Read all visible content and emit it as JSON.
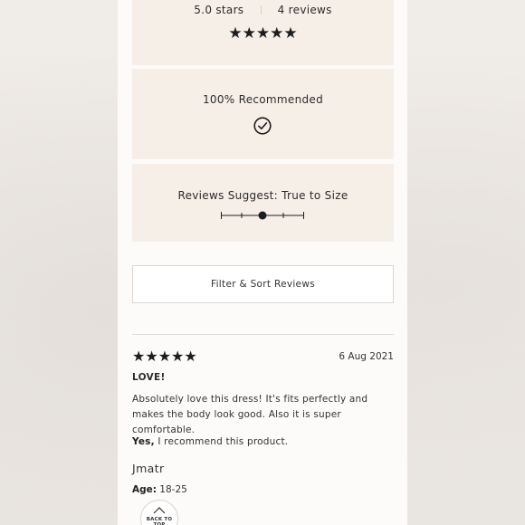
{
  "summary": {
    "rating_text": "5.0 stars",
    "review_count_text": "4 reviews",
    "stars": "★★★★★",
    "rating": 5
  },
  "recommend": {
    "label": "100% Recommended",
    "icon": "check-circle-icon"
  },
  "size_fit": {
    "label": "Reviews Suggest: True to Size",
    "scale_position": 0.5
  },
  "filter": {
    "label": "Filter & Sort Reviews"
  },
  "review": {
    "stars": "★★★★★",
    "rating": 5,
    "date": "6 Aug 2021",
    "title": "LOVE!",
    "body": "Absolutely love this dress! It's fits perfectly and makes the body look good. Also it is super comfortable.",
    "recommend_yes": "Yes,",
    "recommend_text": " I recommend this product.",
    "author": "Jmatr",
    "age_label": "Age:",
    "age_value": " 18-25"
  },
  "back_to_top": {
    "label": "BACK TO TOP",
    "icon": "chevron-up-icon"
  },
  "colors": {
    "panel_bg": "#fdfbfa",
    "box_bg": "#f6efe8",
    "page_bg": "#ece8e4",
    "text": "#2b2b2b"
  }
}
